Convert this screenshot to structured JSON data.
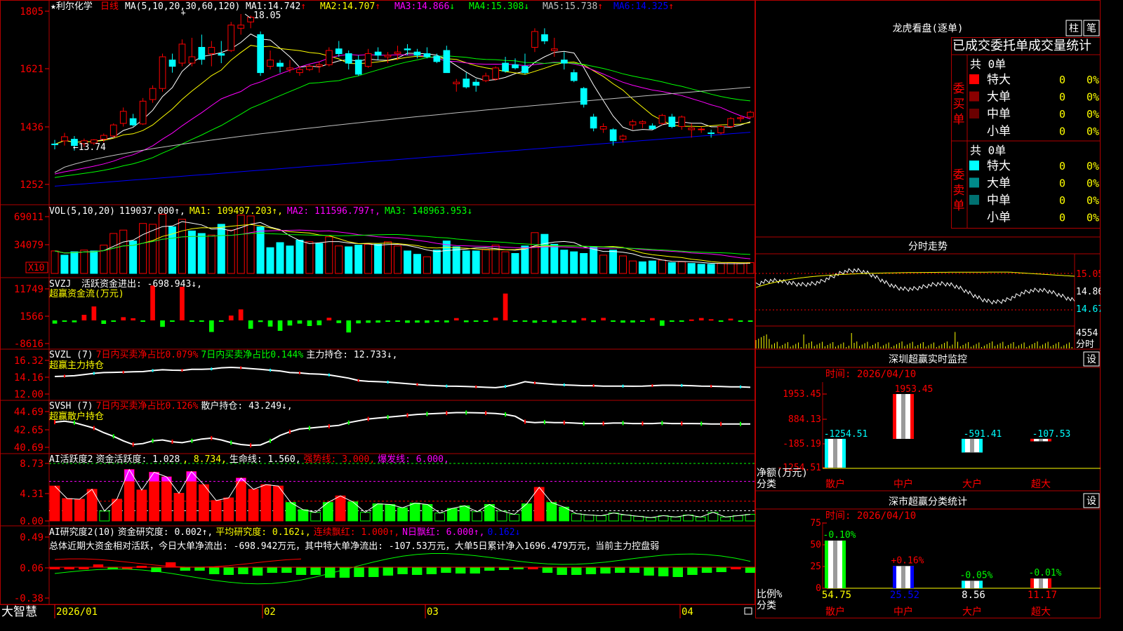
{
  "header": {
    "stock_name": "★利尔化学",
    "period": "日线",
    "ma_param": "MA(5,10,20,30,60,120)",
    "ma": [
      {
        "label": "MA1:",
        "value": "14.742",
        "arrow": "↑",
        "color": "#ffffff"
      },
      {
        "label": "MA2:",
        "value": "14.707",
        "arrow": "↑",
        "color": "#ffff00"
      },
      {
        "label": "MA3:",
        "value": "14.866",
        "arrow": "↓",
        "color": "#ff00ff"
      },
      {
        "label": "MA4:",
        "value": "15.308",
        "arrow": "↓",
        "color": "#00ff00"
      },
      {
        "label": "MA5:",
        "value": "15.738",
        "arrow": "↑",
        "color": "#c0c0c0"
      },
      {
        "label": "MA6:",
        "value": "14.325",
        "arrow": "↑",
        "color": "#0000ff"
      }
    ],
    "high_note": "18.05",
    "low_note": "←13.74"
  },
  "colors": {
    "up": "#ff0000",
    "down": "#00ffff",
    "up_dark": "#9b0000",
    "frame": "#b00000",
    "axis": "#ff0000",
    "yellow": "#ffff00",
    "green": "#00ff00",
    "magenta": "#ff00ff",
    "white": "#ffffff",
    "blue": "#0000ff",
    "gray": "#c0c0c0"
  },
  "x_axis": {
    "labels": [
      "2026/01",
      "02",
      "03",
      "04"
    ],
    "brand": "大智慧"
  },
  "panels": {
    "kline": {
      "ylabels": [
        "1805",
        "1621",
        "1436",
        "1252"
      ]
    },
    "vol": {
      "ylabels": [
        "69011",
        "34079"
      ],
      "unit": "X10",
      "title": "VOL(5,10,20)",
      "value": "119037.000↑,",
      "ma1": "MA1: 109497.203↑,",
      "ma2": "MA2: 111596.797↑,",
      "ma3": "MA3: 148963.953↓"
    },
    "svzj": {
      "ylabels": [
        "11749",
        "1566",
        "-8616"
      ],
      "title": "SVZJ",
      "line1": "活跃资金进出: -698.943↓,",
      "line2": "超赢资金流(万元)"
    },
    "svzl": {
      "ylabels": [
        "16.32",
        "14.16",
        "12.00"
      ],
      "title": "SVZL (7)",
      "part1": "7日内买卖净占比0.079%",
      "part2": "7日内买卖净占比0.144%",
      "part3": "主力持仓: 12.733↓,",
      "line2": "超赢主力持仓"
    },
    "svsh": {
      "ylabels": [
        "44.69",
        "42.65",
        "40.69"
      ],
      "title": "SVSH (7)",
      "part1": "7日内买卖净占比0.126%",
      "part2": "散户持仓: 43.249↓,",
      "line2": "超赢散户持仓"
    },
    "ai1": {
      "ylabels": [
        "8.73",
        "4.31",
        "0.00"
      ],
      "title": "AI活跃度2",
      "part1": "资金活跃度: 1.028",
      "part2": ", 8.734,",
      "part3": "生命线: 1.560,",
      "part4": "强势线: 3.000,",
      "part5": "爆发线: 6.000,"
    },
    "ai2": {
      "ylabels": [
        "0.49",
        "0.06",
        "-0.38"
      ],
      "title": "AI研究度2(10)",
      "part1": "资金研究度: 0.002↑,",
      "part2": "平均研究度: 0.162↓,",
      "part3": "连续飘红: 1.000↑,",
      "part4": "N日飘红: 6.000↑,",
      "part5": "0.162↓",
      "summary": "总体近期大资金相对活跃，今日大单净流出: -698.942万元，其中特大单净流出: -107.53万元，大单5日累计净入1696.479万元，当前主力控盘弱"
    }
  },
  "right": {
    "dragon": {
      "title": "龙虎看盘(逐单)",
      "tab1": "柱",
      "tab2": "笔",
      "subtitle": "已成交委托单成交量统计",
      "buy": {
        "side_label": "委买单",
        "total": "共 0单",
        "rows": [
          {
            "name": "特大",
            "count": "0",
            "pct": "0%",
            "color": "#ff0000"
          },
          {
            "name": "大单",
            "count": "0",
            "pct": "0%",
            "color": "#8b0000"
          },
          {
            "name": "中单",
            "count": "0",
            "pct": "0%",
            "color": "#6b0000"
          },
          {
            "name": "小单",
            "count": "0",
            "pct": "0%",
            "color": "#000000"
          }
        ]
      },
      "sell": {
        "side_label": "委卖单",
        "total": "共 0单",
        "rows": [
          {
            "name": "特大",
            "count": "0",
            "pct": "0%",
            "color": "#00ffff"
          },
          {
            "name": "大单",
            "count": "0",
            "pct": "0%",
            "color": "#008b8b"
          },
          {
            "name": "中单",
            "count": "0",
            "pct": "0%",
            "color": "#007070"
          },
          {
            "name": "小单",
            "count": "0",
            "pct": "0%",
            "color": "#000000"
          }
        ]
      }
    },
    "intraday": {
      "title": "分时走势",
      "labels": [
        "15.05",
        "14.86",
        "14.67",
        "4554",
        "分时"
      ]
    },
    "sz_monitor": {
      "title": "深圳超赢实时监控",
      "settings": "设",
      "time": "时间: 2026/04/10",
      "ylabels": [
        "1953.45",
        "884.13",
        "-185.19",
        "-1254.51"
      ],
      "ylabel_name": "净额(万元)",
      "xlabel_name": "分类",
      "categories": [
        "散户",
        "中户",
        "大户",
        "超大"
      ],
      "values": [
        -1254.51,
        1953.45,
        -591.41,
        -107.53
      ],
      "value_labels": [
        "-1254.51",
        "1953.45",
        "-591.41",
        "-107.53"
      ]
    },
    "sz_class": {
      "title": "深市超赢分类统计",
      "settings": "设",
      "time": "时间: 2026/04/10",
      "ylabels": [
        "75",
        "50",
        "25",
        "0"
      ],
      "ylabel_name": "比例%",
      "xlabel_name": "分类",
      "categories": [
        "散户",
        "中户",
        "大户",
        "超大"
      ],
      "values": [
        54.75,
        25.52,
        8.56,
        11.17
      ],
      "value_labels": [
        "54.75",
        "25.52",
        "8.56",
        "11.17"
      ],
      "changes": [
        "-0.10%",
        "+0.16%",
        "-0.05%",
        "-0.01%"
      ]
    }
  },
  "chart_data": [
    {
      "type": "candlestick",
      "title": "",
      "ylim": [
        12.52,
        18.05
      ],
      "ohlc": [
        [
          13.95,
          14.08,
          13.78,
          13.94
        ],
        [
          14.05,
          14.3,
          13.9,
          14.18
        ],
        [
          14.1,
          14.2,
          13.74,
          13.9
        ],
        [
          13.96,
          14.12,
          13.85,
          14.05
        ],
        [
          13.98,
          14.1,
          13.92,
          14.08
        ],
        [
          14.1,
          14.28,
          14.0,
          14.22
        ],
        [
          14.2,
          14.6,
          14.15,
          14.55
        ],
        [
          14.6,
          15.1,
          14.5,
          14.98
        ],
        [
          14.75,
          14.9,
          14.5,
          14.55
        ],
        [
          14.58,
          15.4,
          14.55,
          15.3
        ],
        [
          15.35,
          15.8,
          15.25,
          15.7
        ],
        [
          15.7,
          16.8,
          15.6,
          16.7
        ],
        [
          16.6,
          16.8,
          16.2,
          16.4
        ],
        [
          16.5,
          17.25,
          16.4,
          17.1
        ],
        [
          16.5,
          17.3,
          16.4,
          16.7
        ],
        [
          17.0,
          17.4,
          16.45,
          16.62
        ],
        [
          16.8,
          17.2,
          16.4,
          17.0
        ],
        [
          16.8,
          17.2,
          16.5,
          16.75
        ],
        [
          16.9,
          17.8,
          16.85,
          17.7
        ],
        [
          17.6,
          18.05,
          17.4,
          17.7
        ],
        [
          17.8,
          18.0,
          17.6,
          17.95
        ],
        [
          17.4,
          17.5,
          16.1,
          16.2
        ],
        [
          16.4,
          16.9,
          16.3,
          16.6
        ],
        [
          16.5,
          16.6,
          16.2,
          16.4
        ],
        [
          16.3,
          16.6,
          16.2,
          16.35
        ],
        [
          16.2,
          16.4,
          16.1,
          16.3
        ],
        [
          16.3,
          16.45,
          16.25,
          16.4
        ],
        [
          16.4,
          16.55,
          16.2,
          16.45
        ],
        [
          16.45,
          17.0,
          16.4,
          16.9
        ],
        [
          16.95,
          17.2,
          16.7,
          16.8
        ],
        [
          16.8,
          16.9,
          16.3,
          16.5
        ],
        [
          16.6,
          16.75,
          16.1,
          16.15
        ],
        [
          16.4,
          16.95,
          16.35,
          16.8
        ],
        [
          16.85,
          17.0,
          16.6,
          16.75
        ],
        [
          16.7,
          16.85,
          16.5,
          16.75
        ],
        [
          16.8,
          17.05,
          16.6,
          16.85
        ],
        [
          16.95,
          17.1,
          16.75,
          16.92
        ],
        [
          16.85,
          16.95,
          16.65,
          16.75
        ],
        [
          16.8,
          17.0,
          16.65,
          16.7
        ],
        [
          16.72,
          16.8,
          16.5,
          16.55
        ],
        [
          16.9,
          17.05,
          16.2,
          16.2
        ],
        [
          15.85,
          16.0,
          15.6,
          15.9
        ],
        [
          16.0,
          16.2,
          15.7,
          15.75
        ],
        [
          15.9,
          16.0,
          15.6,
          15.8
        ],
        [
          15.95,
          16.2,
          15.9,
          16.1
        ],
        [
          16.0,
          16.4,
          15.95,
          16.35
        ],
        [
          16.5,
          16.7,
          16.2,
          16.25
        ],
        [
          16.45,
          16.65,
          16.3,
          16.35
        ],
        [
          16.4,
          16.8,
          16.15,
          16.2
        ],
        [
          17.0,
          17.6,
          16.85,
          17.5
        ],
        [
          17.4,
          17.6,
          17.1,
          17.2
        ],
        [
          16.9,
          17.3,
          16.7,
          16.95
        ],
        [
          16.6,
          16.85,
          16.3,
          16.5
        ],
        [
          16.2,
          16.3,
          15.9,
          15.95
        ],
        [
          15.7,
          15.75,
          15.1,
          15.2
        ],
        [
          14.8,
          14.9,
          14.35,
          14.45
        ],
        [
          14.42,
          14.6,
          14.3,
          14.5
        ],
        [
          14.4,
          14.45,
          13.9,
          14.05
        ],
        [
          14.1,
          14.25,
          14.0,
          14.2
        ],
        [
          14.55,
          14.72,
          14.4,
          14.65
        ],
        [
          14.6,
          14.7,
          14.45,
          14.65
        ],
        [
          14.52,
          14.6,
          14.4,
          14.43
        ],
        [
          14.6,
          14.9,
          14.55,
          14.85
        ],
        [
          14.8,
          14.9,
          14.45,
          14.5
        ],
        [
          14.5,
          14.85,
          14.4,
          14.8
        ],
        [
          14.4,
          14.6,
          14.15,
          14.45
        ],
        [
          14.4,
          14.5,
          14.3,
          14.42
        ],
        [
          14.3,
          14.4,
          14.15,
          14.28
        ],
        [
          14.3,
          14.55,
          14.25,
          14.5
        ],
        [
          14.5,
          14.8,
          14.45,
          14.75
        ],
        [
          14.75,
          14.85,
          14.65,
          14.78
        ],
        [
          14.8,
          15.0,
          14.75,
          14.95
        ]
      ]
    },
    {
      "type": "bar",
      "title": "VOL(5,10,20)",
      "ylim": [
        0,
        69011
      ],
      "values": [
        27000,
        22000,
        26000,
        28000,
        27000,
        34000,
        48000,
        52000,
        39000,
        60000,
        59000,
        71000,
        56000,
        65000,
        51000,
        48000,
        46000,
        59000,
        52000,
        70000,
        69000,
        56000,
        31000,
        37000,
        33000,
        40000,
        38000,
        36000,
        44000,
        33000,
        32000,
        34000,
        35000,
        35000,
        38000,
        33000,
        27000,
        23000,
        20000,
        28000,
        39000,
        32000,
        27000,
        27000,
        29000,
        34000,
        26000,
        24000,
        33000,
        49000,
        47000,
        35000,
        28000,
        26000,
        24000,
        32000,
        22000,
        28000,
        21000,
        15000,
        14000,
        15000,
        16000,
        13000,
        14000,
        12000,
        11000,
        11000,
        12000,
        13000,
        12000,
        13000
      ],
      "up": [
        1,
        0,
        0,
        1,
        0,
        1,
        1,
        1,
        0,
        1,
        1,
        1,
        0,
        1,
        0,
        0,
        1,
        0,
        1,
        1,
        1,
        0,
        0,
        0,
        0,
        0,
        1,
        0,
        1,
        1,
        0,
        0,
        1,
        0,
        1,
        1,
        0,
        0,
        1,
        0,
        0,
        0,
        0,
        0,
        1,
        1,
        1,
        0,
        0,
        1,
        0,
        0,
        0,
        0,
        0,
        0,
        1,
        0,
        1,
        1,
        0,
        0,
        1,
        0,
        1,
        0,
        0,
        0,
        1,
        1,
        1,
        1
      ]
    },
    {
      "type": "bar",
      "title": "SVZJ",
      "ylim": [
        -8616,
        11749
      ],
      "values": [
        -1200,
        -350,
        -700,
        2100,
        5200,
        -1300,
        -500,
        1200,
        800,
        -250,
        13000,
        -2400,
        -300,
        12500,
        -350,
        -350,
        -4300,
        -330,
        1800,
        4100,
        -3100,
        -600,
        -2300,
        -3900,
        -1900,
        -1200,
        -2100,
        -1800,
        1000,
        -1000,
        -4500,
        -1100,
        -900,
        -800,
        -300,
        -340,
        -900,
        -820,
        -900,
        -600,
        -750,
        850,
        -650,
        -500,
        -400,
        1000,
        10000,
        -330,
        -350,
        -850,
        -320,
        -900,
        -350,
        -800,
        850,
        -600,
        950,
        -450,
        -800,
        -750,
        -400,
        850,
        -2000,
        -400,
        -300,
        350,
        900,
        450,
        -340,
        650,
        -400,
        -350
      ],
      "note": "estimated values"
    },
    {
      "type": "line",
      "title": "SVZL",
      "ylim": [
        12.0,
        16.32
      ],
      "values": [
        14.2,
        14.25,
        14.3,
        14.45,
        14.6,
        14.7,
        14.72,
        14.75,
        14.8,
        14.82,
        14.95,
        15.05,
        15.0,
        14.98,
        15.1,
        15.1,
        15.15,
        15.3,
        15.35,
        15.3,
        15.2,
        15.1,
        15.0,
        14.9,
        14.7,
        14.65,
        14.55,
        14.5,
        14.4,
        14.2,
        14.0,
        13.7,
        13.6,
        13.55,
        13.5,
        13.4,
        13.3,
        13.2,
        13.1,
        13.05,
        13.0,
        12.98,
        12.95,
        12.9,
        12.85,
        12.8,
        12.95,
        13.2,
        13.55,
        13.4,
        13.3,
        13.2,
        13.15,
        13.1,
        13.05,
        13.05,
        13.0,
        13.0,
        13.0,
        12.98,
        13.0,
        13.05,
        13.1,
        13.1,
        13.08,
        13.05,
        13.0,
        12.98,
        12.95,
        12.9,
        12.9,
        12.85
      ]
    },
    {
      "type": "line",
      "title": "SVSH",
      "ylim": [
        40.69,
        44.69
      ],
      "values": [
        43.45,
        43.55,
        43.4,
        43.1,
        42.8,
        42.3,
        41.9,
        41.4,
        41.0,
        41.1,
        41.4,
        41.5,
        41.3,
        41.2,
        41.4,
        41.6,
        41.7,
        41.5,
        41.2,
        41.0,
        40.9,
        40.95,
        41.4,
        42.0,
        42.4,
        42.7,
        42.8,
        42.9,
        43.0,
        43.1,
        43.4,
        43.6,
        43.8,
        43.9,
        44.0,
        44.1,
        44.2,
        44.3,
        44.35,
        44.4,
        44.45,
        44.5,
        44.5,
        44.48,
        44.45,
        44.4,
        44.3,
        44.1,
        43.5,
        43.4,
        43.45,
        43.4,
        43.4,
        43.35,
        43.3,
        43.3,
        43.3,
        43.35,
        43.35,
        43.3,
        43.3,
        43.3,
        43.35,
        43.3,
        43.3,
        43.3,
        43.28,
        43.25,
        43.25,
        43.25,
        43.25,
        43.25
      ]
    },
    {
      "type": "bar",
      "title": "AI活跃度2",
      "ylim": [
        0,
        8.73
      ],
      "values": [
        5.3,
        3.4,
        3.3,
        4.8,
        1.5,
        3.3,
        7.8,
        4.7,
        7.4,
        6.7,
        4.2,
        7.5,
        5.5,
        3.1,
        3.5,
        6.5,
        4.8,
        5.5,
        5.3,
        2.8,
        1.7,
        1.3,
        2.8,
        3.8,
        2.9,
        1.3,
        2.6,
        2.5,
        2.0,
        2.7,
        2.5,
        1.2,
        1.9,
        2.3,
        1.4,
        2.5,
        1.5,
        1.0,
        2.6,
        5.1,
        2.8,
        2.1,
        1.1,
        0.9,
        0.8,
        1.2,
        0.9,
        0.7,
        0.5,
        0.8,
        0.6,
        0.9,
        0.6,
        1.3,
        0.6,
        0.8,
        1.0
      ],
      "lines": {
        "生命线": 1.56,
        "强势线": 3.0,
        "爆发线": 6.0
      }
    },
    {
      "type": "bar",
      "title": "AI研究度2(10)",
      "ylim": [
        -0.38,
        0.49
      ],
      "values": [
        0.06,
        0.04,
        0.04,
        0.1,
        0.03,
        0.05,
        0.08,
        -0.01,
        0.13,
        0.01,
        0.01,
        -0.04,
        -0.05,
        -0.04,
        -0.06,
        -0.02,
        -0.02,
        -0.05,
        -0.05,
        -0.09,
        -0.09,
        -0.08,
        -0.08,
        -0.06,
        -0.04,
        -0.05,
        -0.04,
        -0.02,
        -0.03,
        -0.03,
        0.01,
        0.02,
        0.03,
        0.05,
        -0.02,
        -0.05,
        -0.05,
        -0.04,
        -0.03,
        -0.02,
        -0.02,
        -0.06,
        -0.07,
        -0.08,
        -0.05,
        -0.02,
        -0.01,
        0.05,
        -0.02
      ],
      "series_line": "平均研究度"
    }
  ]
}
